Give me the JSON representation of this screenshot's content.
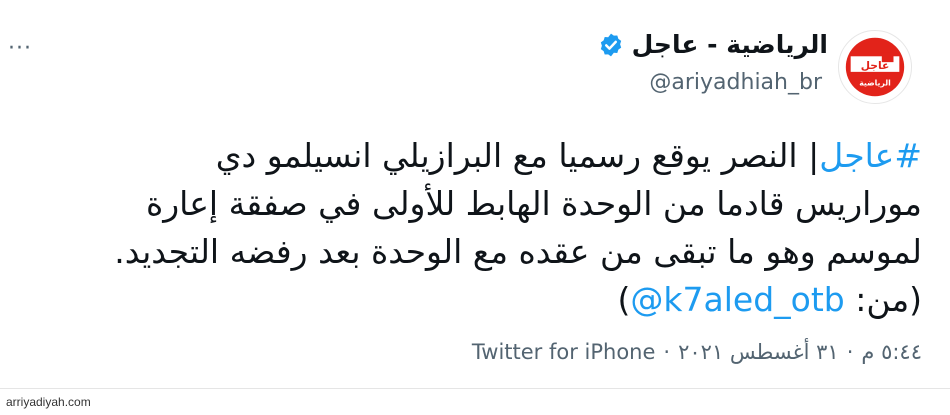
{
  "account": {
    "name": "الرياضية - عاجل",
    "handle": "@ariyadhiah_br",
    "verified": true,
    "avatar_text_top": "عاجل",
    "avatar_text_bottom": "الرياضية",
    "colors": {
      "avatar_red": "#e2231a",
      "verified_blue": "#1d9bf0"
    }
  },
  "tweet": {
    "hashtag": "#عاجل",
    "line1_rest": "| النصر يوقع رسميا مع البرازيلي انسيلمو دي",
    "line2": "موراريس قادما من الوحدة الهابط للأولى في صفقة إعارة",
    "line3": "لموسم وهو ما تبقى من عقده مع الوحدة بعد رفضه التجديد.",
    "line4_prefix": "(من: ",
    "mention": "@k7aled_otb",
    "line4_suffix": ")",
    "link_color": "#1d9bf0"
  },
  "meta": {
    "time": "٥:٤٤ م",
    "sep1": "·",
    "date": "٣١ أغسطس ٢٠٢١",
    "sep2": "·",
    "source": "Twitter for iPhone"
  },
  "menu": {
    "icon": "more-icon",
    "glyph": "···"
  },
  "watermark": "arriyadiyah.com"
}
